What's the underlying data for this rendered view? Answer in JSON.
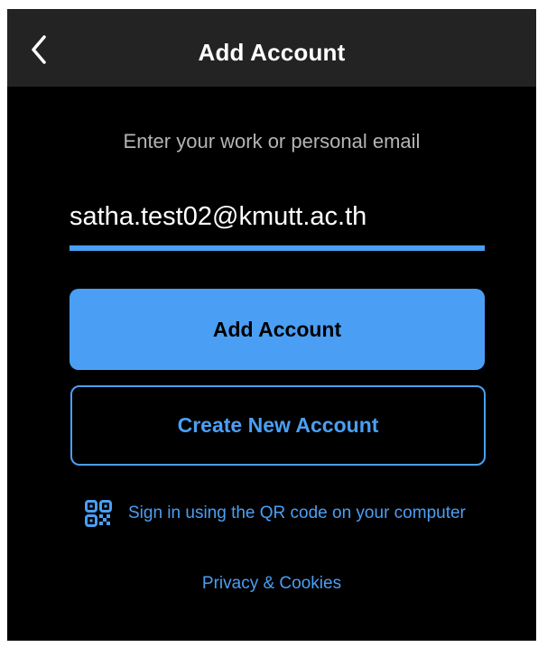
{
  "header": {
    "title": "Add Account",
    "back_icon": "chevron-left-icon"
  },
  "form": {
    "prompt": "Enter your work or personal email",
    "email_value": "satha.test02@kmutt.ac.th"
  },
  "buttons": {
    "add_account": "Add Account",
    "create_account": "Create New Account"
  },
  "qr": {
    "icon": "qr-code-icon",
    "label": "Sign in using the QR code on your computer"
  },
  "footer": {
    "privacy_link": "Privacy & Cookies"
  },
  "colors": {
    "accent": "#4a9ff5",
    "header_bg": "#232323",
    "background": "#000000",
    "prompt_text": "#b4b4b8"
  }
}
